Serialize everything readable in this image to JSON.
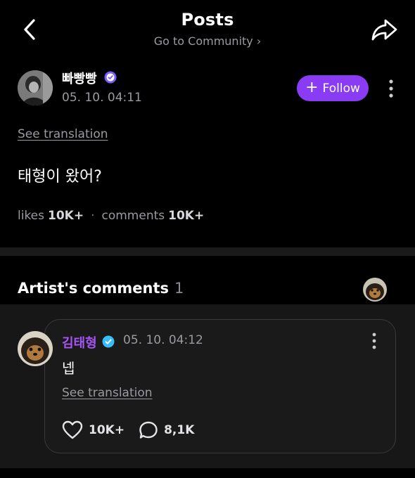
{
  "header": {
    "title": "Posts",
    "subtitle": "Go to Community ›"
  },
  "post": {
    "author": "빠빵빵",
    "time": "05. 10. 04:11",
    "follow_label": "Follow",
    "see_translation": "See translation",
    "body": "태형이 왔어?",
    "likes_label": "likes",
    "likes_count": "10K+",
    "comments_label": "comments",
    "comments_count": "10K+"
  },
  "artist_comments": {
    "title": "Artist's comments",
    "count": "1",
    "comment": {
      "author": "김태형",
      "time": "05. 10. 04:12",
      "text": "넵",
      "see_translation": "See translation",
      "likes": "10K+",
      "replies": "8,1K"
    }
  },
  "colors": {
    "background": "#000000",
    "accent": "#8a3cf5",
    "artist_name": "#a855f7",
    "verified": "#7c5cff",
    "muted_text": "#9a9aa0"
  },
  "icons": [
    "back-arrow-icon",
    "share-icon",
    "verified-badge-icon",
    "plus-icon",
    "more-vertical-icon",
    "heart-icon",
    "comment-bubble-icon"
  ]
}
